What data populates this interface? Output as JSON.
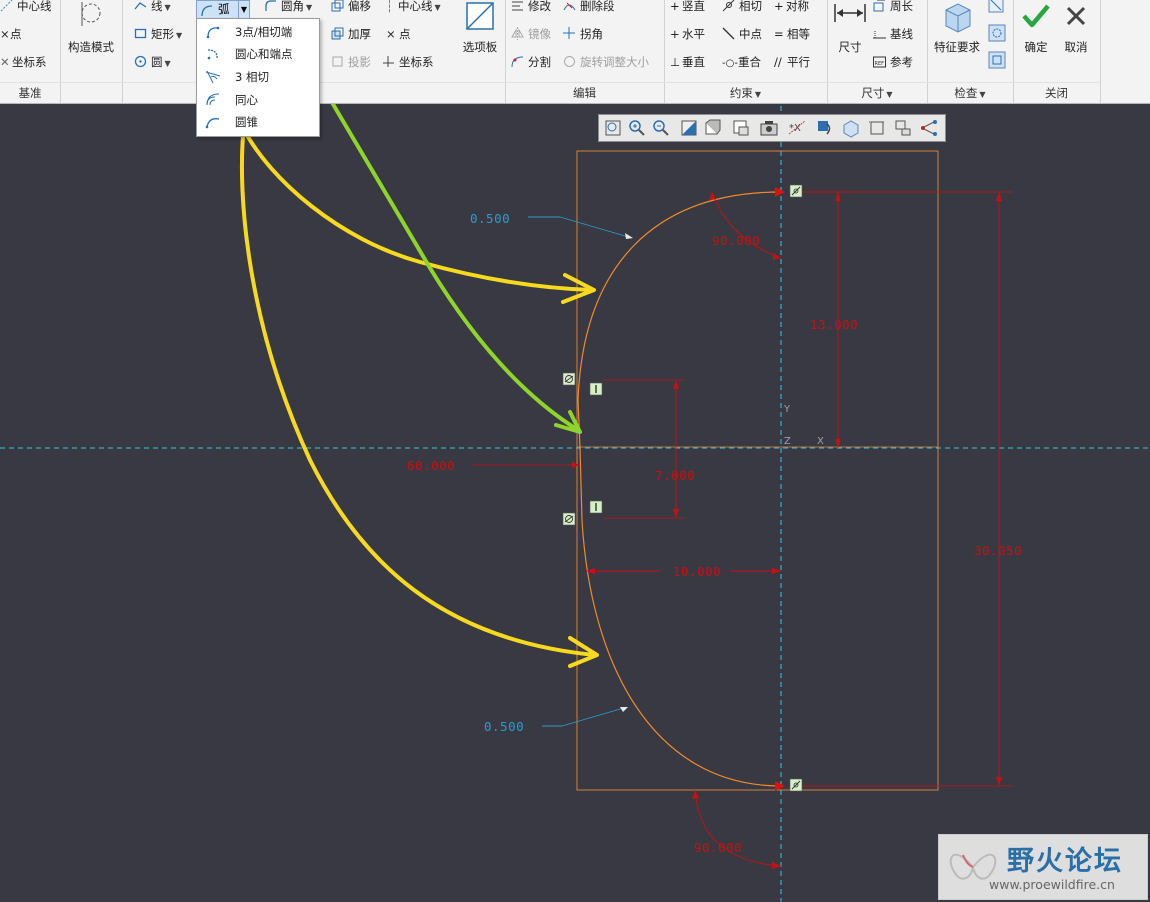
{
  "ribbon": {
    "datum": {
      "label": "基准",
      "centerline": "中心线",
      "point": "点",
      "coordsys": "坐标系",
      "construction_mode": "构造模式"
    },
    "sketch": {
      "line": "线",
      "rectangle": "矩形",
      "circle": "圆",
      "arc": "弧",
      "fillet": "圆角",
      "offset": "偏移",
      "thicken": "加厚",
      "project": "投影",
      "centerline": "中心线",
      "point": "点",
      "coordsys": "坐标系",
      "palette": "选项板"
    },
    "arc_menu": [
      {
        "label": "3点/相切端",
        "icon": "arc-3point-icon"
      },
      {
        "label": "圆心和端点",
        "icon": "arc-center-ends-icon"
      },
      {
        "label": "3 相切",
        "icon": "arc-3tangent-icon"
      },
      {
        "label": "同心",
        "icon": "arc-concentric-icon"
      },
      {
        "label": "圆锥",
        "icon": "arc-conic-icon"
      }
    ],
    "edit": {
      "label": "编辑",
      "modify": "修改",
      "delete_segment": "删除段",
      "mirror": "镜像",
      "corner": "拐角",
      "divide": "分割",
      "rotate_resize": "旋转调整大小"
    },
    "constrain": {
      "label": "约束",
      "vertical": "竖直",
      "tangent": "相切",
      "symmetric": "对称",
      "horizontal": "水平",
      "midpoint": "中点",
      "equal": "相等",
      "perpendicular": "垂直",
      "coincident": "重合",
      "parallel": "平行"
    },
    "dimension": {
      "label": "尺寸",
      "normal": "尺寸",
      "perimeter": "周长",
      "baseline": "基线",
      "reference": "参考"
    },
    "inspect": {
      "label": "检查",
      "feature_req": "特征要求"
    },
    "close": {
      "label": "关闭",
      "ok": "确定",
      "cancel": "取消"
    }
  },
  "sketch": {
    "dims": {
      "top_radius": "0.500",
      "top_angle": "90.000",
      "right_height": "13.000",
      "left_angle": "60.000",
      "mid_height": "7.000",
      "overall_height": "30.050",
      "width": "10.000",
      "bottom_radius": "0.500",
      "bottom_angle": "90.000"
    },
    "axis_labels": {
      "y": "Y",
      "z": "Z",
      "x": "X"
    }
  },
  "watermark": {
    "title": "野火论坛",
    "url": "www.proewildfire.cn"
  },
  "colors": {
    "canvas": "#393943",
    "ribbon": "#f3f3f3",
    "profile": "#f08a2a",
    "dimension": "#c81010",
    "centerline": "#35c8e0",
    "annotation_yellow": "#f7da1e",
    "annotation_green": "#8fd42a",
    "ok_green": "#2aa640"
  }
}
